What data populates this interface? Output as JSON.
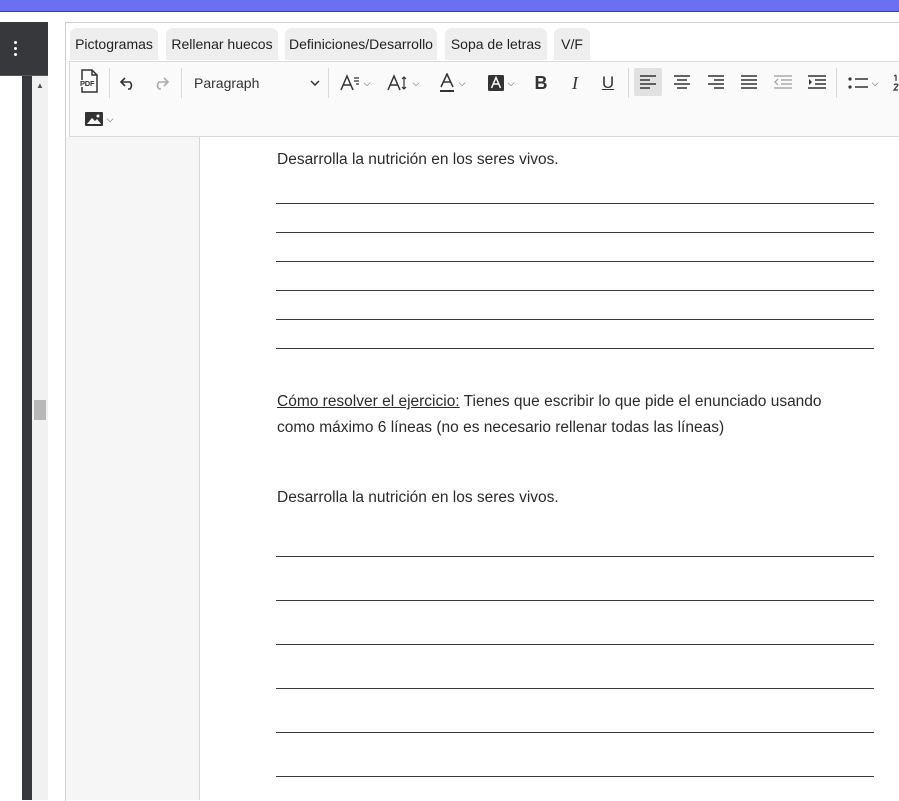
{
  "tabs": [
    "Pictogramas",
    "Rellenar huecos",
    "Definiciones/Desarrollo",
    "Sopa de letras",
    "V/F"
  ],
  "toolbar": {
    "pdf_label": "PDF",
    "block_format": "Paragraph",
    "bold": "B",
    "italic": "I",
    "underline": "U"
  },
  "document": {
    "prompt_1": "Desarrolla la nutrición en los seres vivos.",
    "howto_label": "Cómo resolver el ejercicio:",
    "howto_text_1": " Tienes que escribir lo que pide el enunciado usando",
    "howto_text_2": "como máximo 6 líneas (no es necesario rellenar todas las líneas)",
    "prompt_2": "Desarrolla la nutrición en los seres vivos."
  },
  "colors": {
    "top_strip": "#6b6ff2",
    "sidebar": "#37383b"
  }
}
